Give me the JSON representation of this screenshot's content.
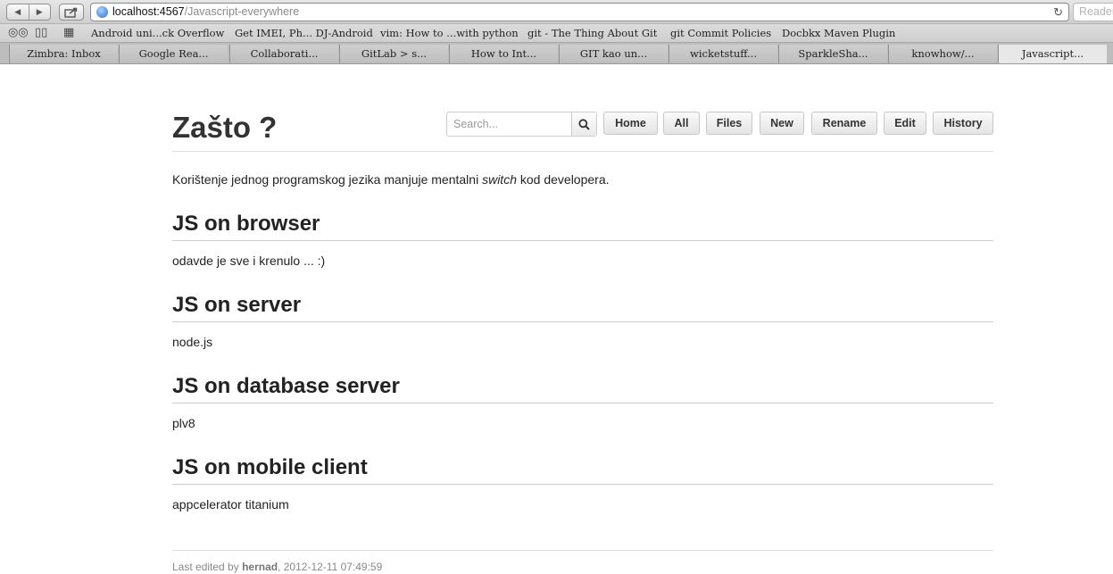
{
  "browser": {
    "url_host": "localhost:4567",
    "url_path": "/Javascript-everywhere",
    "reader_label": "Reader",
    "bookmarks": [
      "Android uni...ck Overflow",
      "Get IMEI, Ph... DJ-Android",
      "vim: How to ...with python",
      "git - The Thing About Git",
      "git Commit Policies",
      "Docbkx Maven Plugin"
    ],
    "tabs": [
      "Zimbra: Inbox",
      "Google Rea...",
      "Collaborati...",
      "GitLab > s...",
      "How to Int...",
      "GIT kao un...",
      "wicketstuff...",
      "SparkleSha...",
      "knowhow/...",
      "Javascript..."
    ],
    "active_tab_index": 9
  },
  "wiki": {
    "page_title": "Zašto ?",
    "search_placeholder": "Search...",
    "nav_buttons": [
      "Home",
      "All",
      "Files",
      "New",
      "Rename",
      "Edit",
      "History"
    ]
  },
  "content": {
    "intro_before": "Korištenje jednog programskog jezika manjuje mentalni ",
    "intro_emphasis": "switch",
    "intro_after": " kod developera.",
    "sections": [
      {
        "heading": "JS on browser",
        "text": "odavde je sve i krenulo ... :)"
      },
      {
        "heading": "JS on server",
        "text": "node.js"
      },
      {
        "heading": "JS on database server",
        "text": "plv8"
      },
      {
        "heading": "JS on mobile client",
        "text": "appcelerator titanium"
      }
    ]
  },
  "footer": {
    "prefix": "Last edited by ",
    "author": "hernad",
    "timestamp": ", 2012-12-11 07:49:59"
  }
}
